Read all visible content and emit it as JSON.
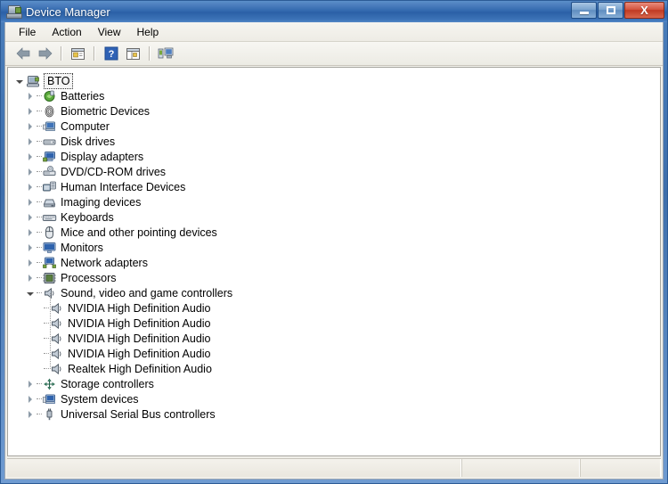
{
  "window": {
    "title": "Device Manager",
    "title_icon": "device-manager-icon",
    "controls": {
      "minimize_label": "Minimize",
      "maximize_label": "Maximize",
      "close_label": "X"
    }
  },
  "menubar": {
    "items": [
      {
        "label": "File",
        "name": "menu-file"
      },
      {
        "label": "Action",
        "name": "menu-action"
      },
      {
        "label": "View",
        "name": "menu-view"
      },
      {
        "label": "Help",
        "name": "menu-help"
      }
    ]
  },
  "toolbar": {
    "buttons": [
      {
        "name": "back-button",
        "icon": "back-arrow-icon"
      },
      {
        "name": "forward-button",
        "icon": "forward-arrow-icon"
      },
      {
        "name": "properties-button",
        "icon": "properties-icon"
      },
      {
        "name": "help-button",
        "icon": "help-question-icon"
      },
      {
        "name": "show-hide-console-tree-button",
        "icon": "console-tree-icon"
      },
      {
        "name": "scan-hardware-changes-button",
        "icon": "scan-hardware-icon"
      }
    ]
  },
  "tree": {
    "root": {
      "label": "BTO",
      "icon": "computer-icon",
      "expanded": true,
      "selected": true
    },
    "items": [
      {
        "label": "Batteries",
        "icon": "battery-icon",
        "expandable": true,
        "expanded": false,
        "level": 1
      },
      {
        "label": "Biometric Devices",
        "icon": "fingerprint-icon",
        "expandable": true,
        "expanded": false,
        "level": 1
      },
      {
        "label": "Computer",
        "icon": "computer-small-icon",
        "expandable": true,
        "expanded": false,
        "level": 1
      },
      {
        "label": "Disk drives",
        "icon": "disk-drive-icon",
        "expandable": true,
        "expanded": false,
        "level": 1
      },
      {
        "label": "Display adapters",
        "icon": "display-adapter-icon",
        "expandable": true,
        "expanded": false,
        "level": 1
      },
      {
        "label": "DVD/CD-ROM drives",
        "icon": "optical-drive-icon",
        "expandable": true,
        "expanded": false,
        "level": 1
      },
      {
        "label": "Human Interface Devices",
        "icon": "hid-icon",
        "expandable": true,
        "expanded": false,
        "level": 1
      },
      {
        "label": "Imaging devices",
        "icon": "imaging-device-icon",
        "expandable": true,
        "expanded": false,
        "level": 1
      },
      {
        "label": "Keyboards",
        "icon": "keyboard-icon",
        "expandable": true,
        "expanded": false,
        "level": 1
      },
      {
        "label": "Mice and other pointing devices",
        "icon": "mouse-icon",
        "expandable": true,
        "expanded": false,
        "level": 1
      },
      {
        "label": "Monitors",
        "icon": "monitor-icon",
        "expandable": true,
        "expanded": false,
        "level": 1
      },
      {
        "label": "Network adapters",
        "icon": "network-adapter-icon",
        "expandable": true,
        "expanded": false,
        "level": 1
      },
      {
        "label": "Processors",
        "icon": "processor-icon",
        "expandable": true,
        "expanded": false,
        "level": 1
      },
      {
        "label": "Sound, video and game controllers",
        "icon": "speaker-icon",
        "expandable": true,
        "expanded": true,
        "level": 1
      },
      {
        "label": "NVIDIA High Definition Audio",
        "icon": "speaker-icon",
        "expandable": false,
        "level": 2
      },
      {
        "label": "NVIDIA High Definition Audio",
        "icon": "speaker-icon",
        "expandable": false,
        "level": 2
      },
      {
        "label": "NVIDIA High Definition Audio",
        "icon": "speaker-icon",
        "expandable": false,
        "level": 2
      },
      {
        "label": "NVIDIA High Definition Audio",
        "icon": "speaker-icon",
        "expandable": false,
        "level": 2
      },
      {
        "label": "Realtek High Definition Audio",
        "icon": "speaker-icon",
        "expandable": false,
        "level": 2
      },
      {
        "label": "Storage controllers",
        "icon": "storage-controller-icon",
        "expandable": true,
        "expanded": false,
        "level": 1
      },
      {
        "label": "System devices",
        "icon": "system-device-icon",
        "expandable": true,
        "expanded": false,
        "level": 1
      },
      {
        "label": "Universal Serial Bus controllers",
        "icon": "usb-icon",
        "expandable": true,
        "expanded": false,
        "level": 1
      }
    ]
  },
  "statusbar": {
    "pane1": "",
    "pane2": "",
    "pane3": ""
  },
  "colors": {
    "titlebar_blue": "#2f66ac",
    "frame_blue": "#4a7ebb",
    "close_red": "#bf3a22",
    "client_bg": "#f0efe9",
    "tree_bg": "#ffffff"
  }
}
